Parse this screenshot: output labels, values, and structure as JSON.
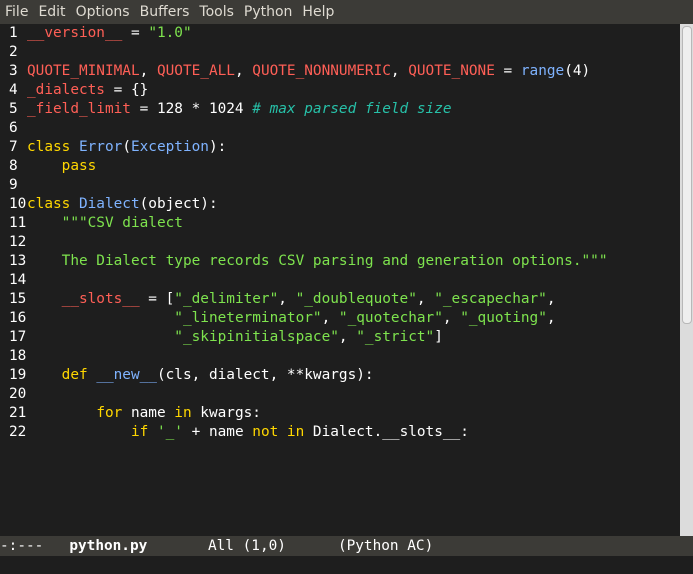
{
  "menubar": {
    "items": [
      "File",
      "Edit",
      "Options",
      "Buffers",
      "Tools",
      "Python",
      "Help"
    ]
  },
  "editor": {
    "lines": [
      {
        "n": "1",
        "segments": [
          [
            "var",
            "__version__"
          ],
          [
            "plain",
            " = "
          ],
          [
            "str",
            "\"1.0\""
          ]
        ]
      },
      {
        "n": "2",
        "segments": []
      },
      {
        "n": "3",
        "segments": [
          [
            "var",
            "QUOTE_MINIMAL"
          ],
          [
            "plain",
            ", "
          ],
          [
            "var",
            "QUOTE_ALL"
          ],
          [
            "plain",
            ", "
          ],
          [
            "var",
            "QUOTE_NONNUMERIC"
          ],
          [
            "plain",
            ", "
          ],
          [
            "var",
            "QUOTE_NONE"
          ],
          [
            "plain",
            " = "
          ],
          [
            "builtin",
            "range"
          ],
          [
            "plain",
            "(4)"
          ]
        ]
      },
      {
        "n": "4",
        "segments": [
          [
            "var",
            "_dialects"
          ],
          [
            "plain",
            " = {}"
          ]
        ]
      },
      {
        "n": "5",
        "segments": [
          [
            "var",
            "_field_limit"
          ],
          [
            "plain",
            " = 128 * 1024 "
          ],
          [
            "cmt",
            "# max parsed field size"
          ]
        ]
      },
      {
        "n": "6",
        "segments": []
      },
      {
        "n": "7",
        "segments": [
          [
            "kw",
            "class "
          ],
          [
            "cls",
            "Error"
          ],
          [
            "plain",
            "("
          ],
          [
            "builtin",
            "Exception"
          ],
          [
            "plain",
            "):"
          ]
        ]
      },
      {
        "n": "8",
        "segments": [
          [
            "plain",
            "    "
          ],
          [
            "kw",
            "pass"
          ]
        ]
      },
      {
        "n": "9",
        "segments": []
      },
      {
        "n": "10",
        "segments": [
          [
            "kw",
            "class "
          ],
          [
            "cls",
            "Dialect"
          ],
          [
            "plain",
            "(object):"
          ]
        ]
      },
      {
        "n": "11",
        "segments": [
          [
            "plain",
            "    "
          ],
          [
            "str",
            "\"\"\"CSV dialect"
          ]
        ]
      },
      {
        "n": "12",
        "segments": []
      },
      {
        "n": "13",
        "segments": [
          [
            "plain",
            "    "
          ],
          [
            "str",
            "The Dialect type records CSV parsing and generation options.\"\"\""
          ]
        ]
      },
      {
        "n": "14",
        "segments": []
      },
      {
        "n": "15",
        "segments": [
          [
            "plain",
            "    "
          ],
          [
            "var",
            "__slots__"
          ],
          [
            "plain",
            " = ["
          ],
          [
            "str",
            "\"_delimiter\""
          ],
          [
            "plain",
            ", "
          ],
          [
            "str",
            "\"_doublequote\""
          ],
          [
            "plain",
            ", "
          ],
          [
            "str",
            "\"_escapechar\""
          ],
          [
            "plain",
            ","
          ]
        ]
      },
      {
        "n": "16",
        "segments": [
          [
            "plain",
            "                 "
          ],
          [
            "str",
            "\"_lineterminator\""
          ],
          [
            "plain",
            ", "
          ],
          [
            "str",
            "\"_quotechar\""
          ],
          [
            "plain",
            ", "
          ],
          [
            "str",
            "\"_quoting\""
          ],
          [
            "plain",
            ","
          ]
        ]
      },
      {
        "n": "17",
        "segments": [
          [
            "plain",
            "                 "
          ],
          [
            "str",
            "\"_skipinitialspace\""
          ],
          [
            "plain",
            ", "
          ],
          [
            "str",
            "\"_strict\""
          ],
          [
            "plain",
            "]"
          ]
        ]
      },
      {
        "n": "18",
        "segments": []
      },
      {
        "n": "19",
        "segments": [
          [
            "plain",
            "    "
          ],
          [
            "kw",
            "def "
          ],
          [
            "fn",
            "__new__"
          ],
          [
            "plain",
            "(cls, dialect, **kwargs):"
          ]
        ]
      },
      {
        "n": "20",
        "segments": []
      },
      {
        "n": "21",
        "segments": [
          [
            "plain",
            "        "
          ],
          [
            "kw",
            "for"
          ],
          [
            "plain",
            " name "
          ],
          [
            "kw",
            "in"
          ],
          [
            "plain",
            " kwargs:"
          ]
        ]
      },
      {
        "n": "22",
        "segments": [
          [
            "plain",
            "            "
          ],
          [
            "kw",
            "if"
          ],
          [
            "plain",
            " "
          ],
          [
            "str",
            "'_'"
          ],
          [
            "plain",
            " + name "
          ],
          [
            "kw",
            "not in"
          ],
          [
            "plain",
            " Dialect.__slots__:"
          ]
        ]
      }
    ]
  },
  "modeline": {
    "status": "-:---",
    "buffer_name": "python.py",
    "position": "All (1,0)",
    "mode": "(Python AC)"
  }
}
